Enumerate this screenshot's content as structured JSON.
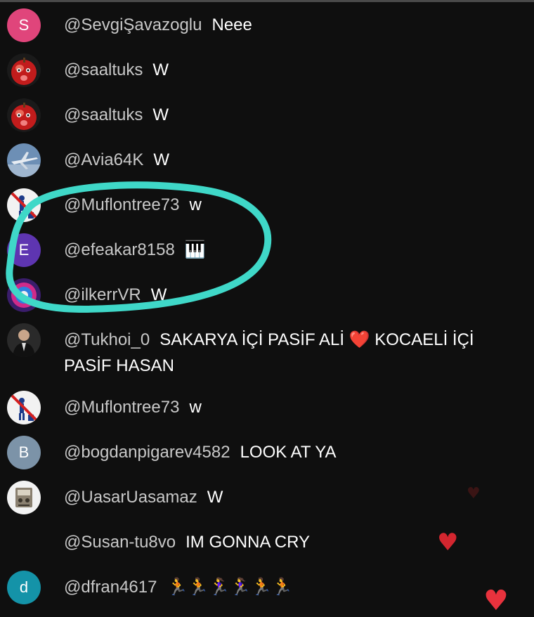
{
  "chat": {
    "messages": [
      {
        "author": "@SevgiŞavazoglu",
        "text": "Neee",
        "avatar": {
          "type": "letter",
          "letter": "S",
          "color": "#e0457b"
        }
      },
      {
        "author": "@saaltuks",
        "text": "W",
        "avatar": {
          "type": "image",
          "icon": "red-apple-face-icon"
        }
      },
      {
        "author": "@saaltuks",
        "text": "W",
        "avatar": {
          "type": "image",
          "icon": "red-apple-face-icon"
        }
      },
      {
        "author": "@Avia64K",
        "text": "W",
        "avatar": {
          "type": "image",
          "icon": "airplane-icon"
        }
      },
      {
        "author": "@Muflontree73",
        "text": "w",
        "avatar": {
          "type": "image",
          "icon": "no-littering-sign-icon"
        }
      },
      {
        "author": "@efeakar8158",
        "text": "🎹",
        "avatar": {
          "type": "letter",
          "letter": "E",
          "color": "#5e35b1"
        }
      },
      {
        "author": "@ilkerrVR",
        "text": "W",
        "avatar": {
          "type": "image",
          "icon": "colorful-logo-icon"
        }
      },
      {
        "author": "@Tukhoi_0",
        "text": "SAKARYA İÇİ PASİF ALİ ❤️ KOCAELİ İÇİ PASİF HASAN",
        "avatar": {
          "type": "image",
          "icon": "person-in-suit-icon"
        }
      },
      {
        "author": "@Muflontree73",
        "text": "w",
        "avatar": {
          "type": "image",
          "icon": "no-littering-sign-icon"
        }
      },
      {
        "author": "@bogdanpigarev4582",
        "text": "LOOK AT YA",
        "avatar": {
          "type": "letter",
          "letter": "B",
          "color": "#7c93a8"
        }
      },
      {
        "author": "@UasarUasamaz",
        "text": "W",
        "avatar": {
          "type": "image",
          "icon": "retro-machine-icon"
        }
      },
      {
        "author": "@Susan-tu8vo",
        "text": "IM GONNA CRY",
        "avatar": {
          "type": "none"
        }
      },
      {
        "author": "@dfran4617",
        "text": "🏃🏃🏃‍♀️🏃‍♀️🏃🏃",
        "avatar": {
          "type": "letter",
          "letter": "d",
          "color": "#1493a8"
        }
      }
    ]
  },
  "reactions": [
    {
      "icon": "dark-heart-icon",
      "glyph": "♥",
      "color": "#3a1414"
    },
    {
      "icon": "red-heart-icon",
      "glyph": "♥",
      "color": "#d3262f"
    },
    {
      "icon": "red-heart-icon",
      "glyph": "♥",
      "color": "#e8323d"
    }
  ],
  "highlight": {
    "color": "#3fd8c8",
    "icon": "hand-drawn-highlight-circle"
  }
}
